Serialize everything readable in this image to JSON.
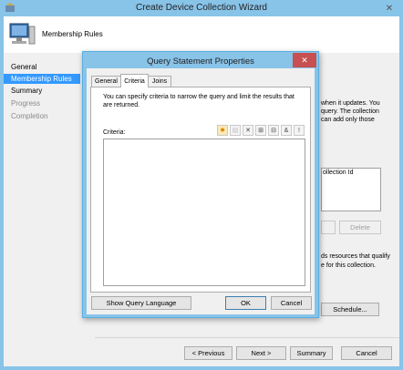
{
  "wizard": {
    "title": "Create Device Collection Wizard",
    "header_text": "Membership Rules",
    "nav": [
      {
        "label": "General"
      },
      {
        "label": "Membership Rules"
      },
      {
        "label": "Summary"
      },
      {
        "label": "Progress"
      },
      {
        "label": "Completion"
      }
    ],
    "bg_text_1": "when it updates. You",
    "bg_text_2": "query. The collection",
    "bg_text_3": "can add only those",
    "bg_table_header": "ollection Id",
    "bg_delete": "Delete",
    "bg_text_4": "ds resources that qualify",
    "bg_text_5": "e for this collection.",
    "schedule_label": "Schedule...",
    "buttons": {
      "previous": "< Previous",
      "next": "Next >",
      "summary": "Summary",
      "cancel": "Cancel"
    }
  },
  "dialog": {
    "title": "Query Statement Properties",
    "tabs": [
      {
        "label": "General"
      },
      {
        "label": "Criteria"
      },
      {
        "label": "Joins"
      }
    ],
    "description": "You can specify criteria to narrow the query and limit the results that are returned.",
    "criteria_label": "Criteria:",
    "show_query_label": "Show Query Language",
    "ok_label": "OK",
    "cancel_label": "Cancel"
  },
  "colors": {
    "accent": "#3399ff",
    "dialog_border": "#5aaee0",
    "titlebar": "#88c3e8"
  },
  "icons": [
    "app-icon",
    "computer-icon",
    "new-criterion-icon",
    "properties-icon",
    "delete-icon",
    "group-icon",
    "ungroup-icon",
    "and-or-icon",
    "not-icon"
  ]
}
